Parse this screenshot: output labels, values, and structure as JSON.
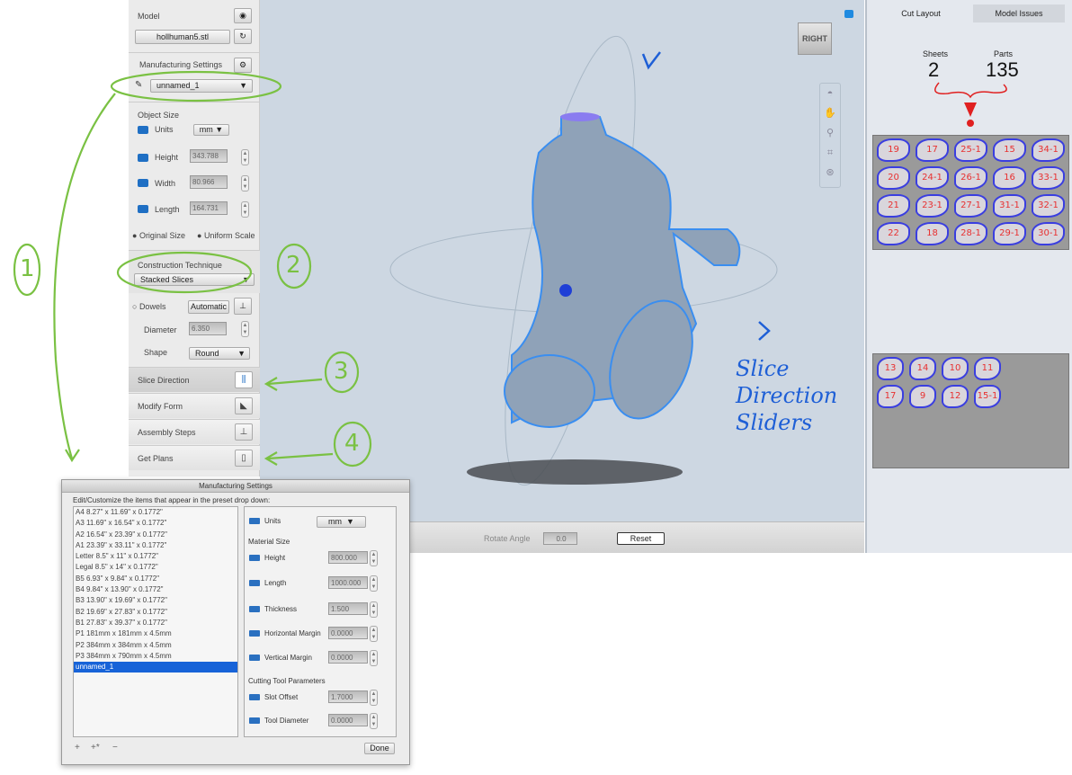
{
  "left_panel": {
    "model_label": "Model",
    "model_file": "hollhuman5.stl",
    "mfg_label": "Manufacturing Settings",
    "mfg_preset": "unnamed_1",
    "object_size_label": "Object Size",
    "units_label": "Units",
    "units_value": "mm",
    "height_label": "Height",
    "height_value": "343.788",
    "width_label": "Width",
    "width_value": "80.966",
    "length_label": "Length",
    "length_value": "164.731",
    "original_size": "Original Size",
    "uniform_scale": "Uniform Scale",
    "construction_label": "Construction Technique",
    "construction_value": "Stacked Slices",
    "dowels_label": "Dowels",
    "dowels_mode": "Automatic",
    "diameter_label": "Diameter",
    "diameter_value": "6.350",
    "shape_label": "Shape",
    "shape_value": "Round",
    "sections": [
      "Slice Direction",
      "Modify Form",
      "Assembly Steps",
      "Get Plans"
    ]
  },
  "viewport": {
    "view_cube": "RIGHT",
    "rotate_label": "Rotate Angle",
    "rotate_value": "0.0",
    "reset_label": "Reset",
    "tools": [
      "orbit-icon",
      "pan-hand-icon",
      "zoom-icon",
      "fit-icon",
      "reset-view-icon"
    ]
  },
  "right_panel": {
    "tabs": [
      "Cut Layout",
      "Model Issues"
    ],
    "active_tab": "Cut Layout",
    "sheets_label": "Sheets",
    "sheets_value": "2",
    "parts_label": "Parts",
    "parts_value": "135",
    "sheet1_parts": [
      "19",
      "17",
      "25-1",
      "15",
      "34-1",
      "20",
      "24-1",
      "26-1",
      "16",
      "33-1",
      "21",
      "23-1",
      "27-1",
      "31-1",
      "32-1",
      "22",
      "18",
      "28-1",
      "29-1",
      "30-1"
    ],
    "sheet2_parts": [
      "13",
      "14",
      "10",
      "11",
      "17",
      "9",
      "12",
      "15-1"
    ]
  },
  "dialog": {
    "title": "Manufacturing Settings",
    "instructions": "Edit/Customize the items that appear in the preset drop down:",
    "presets": [
      "A4 8.27\" x 11.69\" x 0.1772\"",
      "A3 11.69\" x 16.54\" x 0.1772\"",
      "A2 16.54\" x 23.39\" x 0.1772\"",
      "A1 23.39\" x 33.11\" x 0.1772\"",
      "Letter 8.5\" x 11\" x 0.1772\"",
      "Legal 8.5\" x 14\" x 0.1772\"",
      "B5 6.93\" x 9.84\" x 0.1772\"",
      "B4 9.84\" x 13.90\" x 0.1772\"",
      "B3 13.90\" x 19.69\" x 0.1772\"",
      "B2 19.69\" x 27.83\" x 0.1772\"",
      "B1 27.83\" x 39.37\" x 0.1772\"",
      "P1 181mm x 181mm x 4.5mm",
      "P2 384mm x 384mm x 4.5mm",
      "P3 384mm x 790mm x 4.5mm",
      "unnamed_1"
    ],
    "selected_preset": "unnamed_1",
    "units_label": "Units",
    "units_value": "mm",
    "material_size_label": "Material Size",
    "height_label": "Height",
    "height_value": "800.000",
    "length_label": "Length",
    "length_value": "1000.000",
    "thickness_label": "Thickness",
    "thickness_value": "1.500",
    "hmargin_label": "Horizontal Margin",
    "hmargin_value": "0.0000",
    "vmargin_label": "Vertical Margin",
    "vmargin_value": "0.0000",
    "cutting_label": "Cutting Tool Parameters",
    "slot_label": "Slot  Offset",
    "slot_value": "1.7000",
    "tool_label": "Tool Diameter",
    "tool_value": "0.0000",
    "list_buttons": [
      "+",
      "+*",
      "−"
    ],
    "done_label": "Done"
  },
  "annotations": {
    "n1": "1",
    "n2": "2",
    "n3": "3",
    "n4": "4",
    "note": "Slice Direction Sliders",
    "green": "#7ac143",
    "blue": "#1e5fd6",
    "red": "#e02020"
  }
}
